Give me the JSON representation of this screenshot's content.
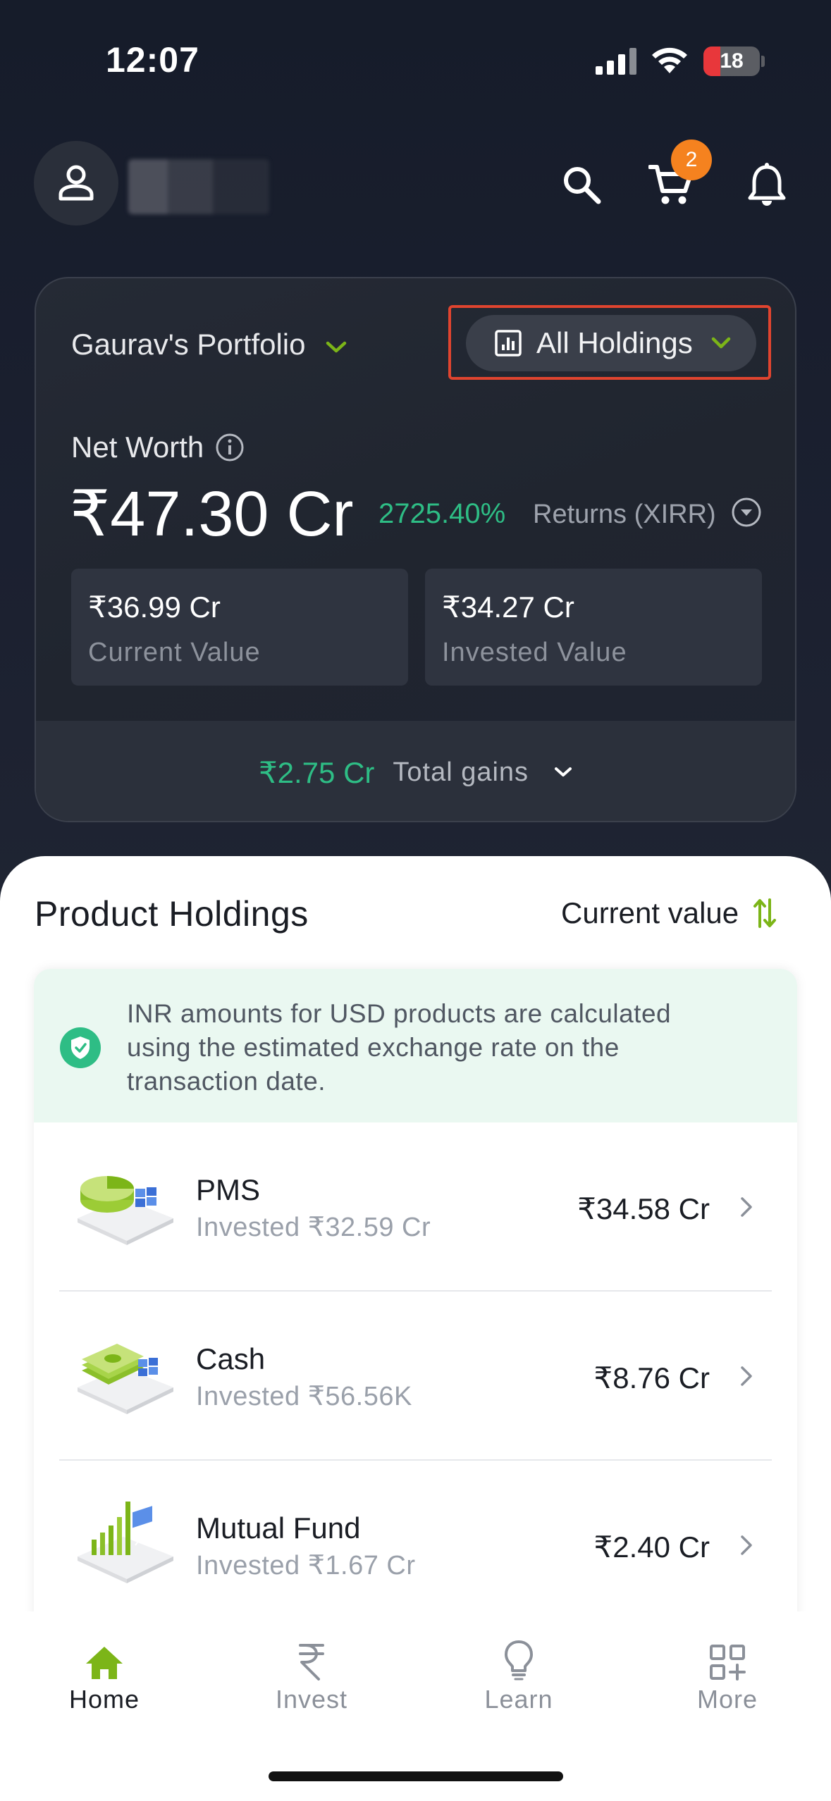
{
  "status_bar": {
    "time": "12:07",
    "battery": "18"
  },
  "header": {
    "cart_badge": "2"
  },
  "portfolio": {
    "name": "Gaurav's Portfolio",
    "holdings_filter": "All Holdings",
    "net_worth_label": "Net Worth",
    "net_worth_value": "₹47.30 Cr",
    "returns_pct": "2725.40%",
    "returns_label": "Returns (XIRR)",
    "current_value": "₹36.99 Cr",
    "current_value_label": "Current Value",
    "invested_value": "₹34.27 Cr",
    "invested_value_label": "Invested Value",
    "total_gains": "₹2.75 Cr",
    "total_gains_label": "Total gains"
  },
  "holdings": {
    "title": "Product Holdings",
    "sort_label": "Current value",
    "notice": "INR amounts for USD products are calculated using the estimated exchange rate on the transaction date.",
    "items": [
      {
        "name": "PMS",
        "invested": "Invested ₹32.59 Cr",
        "value": "₹34.58 Cr",
        "icon": "pms-icon"
      },
      {
        "name": "Cash",
        "invested": "Invested ₹56.56K",
        "value": "₹8.76 Cr",
        "icon": "cash-icon"
      },
      {
        "name": "Mutual Fund",
        "invested": "Invested ₹1.67 Cr",
        "value": "₹2.40 Cr",
        "icon": "mutual-fund-icon"
      }
    ]
  },
  "nav": {
    "items": [
      {
        "label": "Home",
        "icon": "home-icon"
      },
      {
        "label": "Invest",
        "icon": "rupee-icon"
      },
      {
        "label": "Learn",
        "icon": "bulb-icon"
      },
      {
        "label": "More",
        "icon": "grid-plus-icon"
      }
    ]
  },
  "colors": {
    "accent_green": "#2ebd85",
    "brand_lime": "#7cb518",
    "badge_orange": "#f5821f",
    "highlight_red": "#e0442f"
  }
}
